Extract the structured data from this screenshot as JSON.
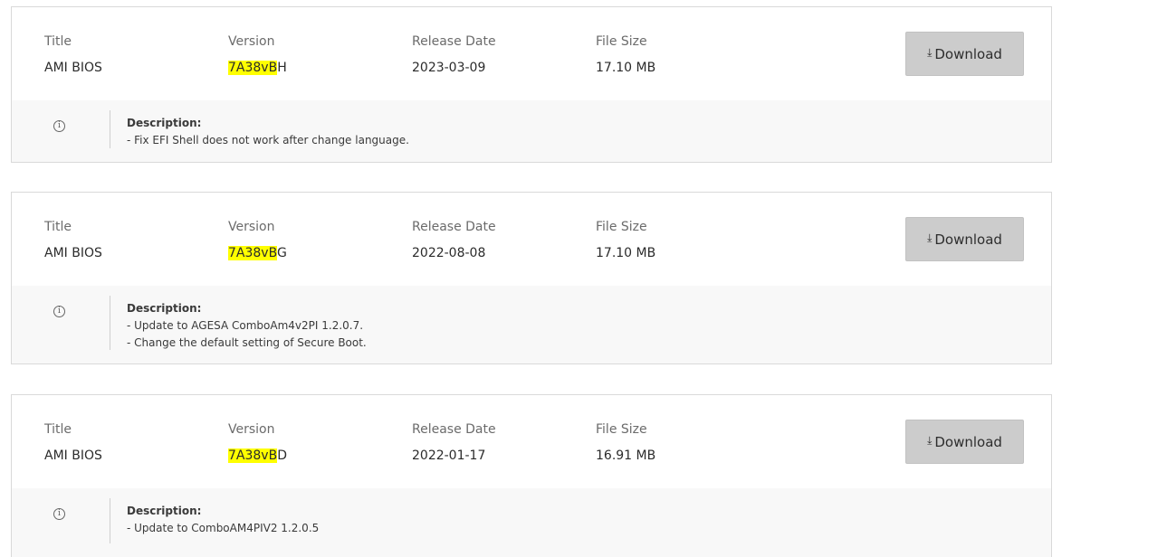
{
  "labels": {
    "title": "Title",
    "version": "Version",
    "release_date": "Release Date",
    "file_size": "File Size",
    "download": "Download",
    "description": "Description:"
  },
  "items": [
    {
      "title": "AMI BIOS",
      "version_highlight": "7A38vB",
      "version_rest": "H",
      "release_date": "2023-03-09",
      "file_size": "17.10 MB",
      "description_lines": [
        "- Fix EFI Shell does not work after change language."
      ]
    },
    {
      "title": "AMI BIOS",
      "version_highlight": "7A38vB",
      "version_rest": "G",
      "release_date": "2022-08-08",
      "file_size": "17.10 MB",
      "description_lines": [
        "- Update to AGESA ComboAm4v2PI 1.2.0.7.",
        "- Change the default setting of Secure Boot."
      ]
    },
    {
      "title": "AMI BIOS",
      "version_highlight": "7A38vB",
      "version_rest": "D",
      "release_date": "2022-01-17",
      "file_size": "16.91 MB",
      "description_lines": [
        "- Update to ComboAM4PIV2 1.2.0.5"
      ]
    }
  ],
  "icons": {
    "info": "info-circle-icon",
    "download": "download-arrow-icon"
  },
  "colors": {
    "highlight": "#ffff00",
    "button_bg": "#cccccc",
    "desc_bg": "#f8f8f8"
  }
}
